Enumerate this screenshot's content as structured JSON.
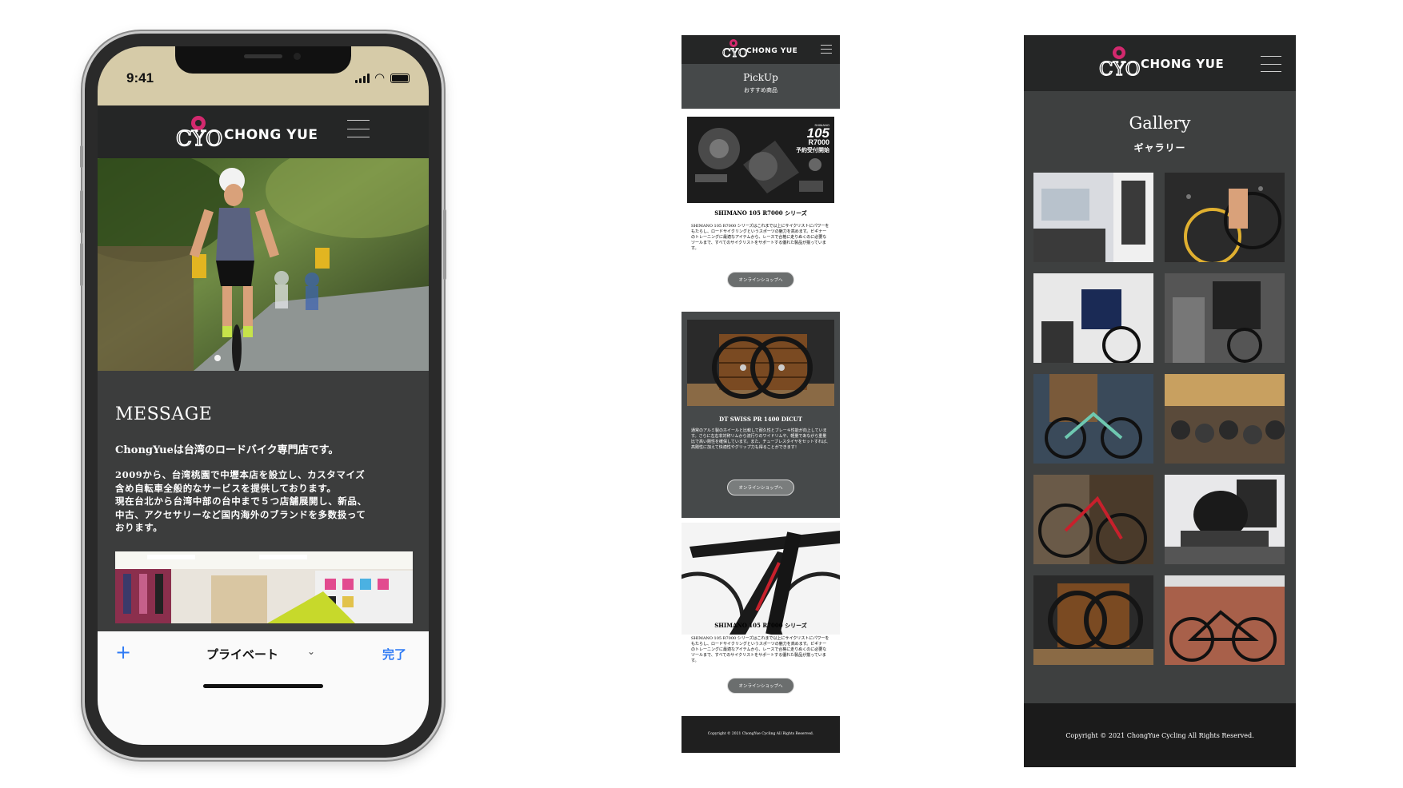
{
  "phone": {
    "status": {
      "time": "9:41"
    },
    "brand": {
      "logo_mark": "CYO",
      "logo_text": "CHONG YUE"
    },
    "message": {
      "title": "MESSAGE",
      "lead": "ChongYueは台湾のロードバイク専門店です。",
      "body_line1": "2009から、台湾桃園で中壢本店を設立し、カスタマイズ含め自転車全般的なサービスを提供しております。",
      "body_line2": "現在台北から台湾中部の台中まで５つ店舗展開し、新品、中古、アクセサリーなど国内海外のブランドを多数扱っております。"
    },
    "safari": {
      "plus": "+",
      "private": "プライベート",
      "chevron": "⌄",
      "done": "完了"
    }
  },
  "pickup": {
    "brand": {
      "logo_mark": "CYO",
      "logo_text": "CHONG YUE"
    },
    "title": "PickUp",
    "subtitle": "おすすめ商品",
    "cards": [
      {
        "title": "SHIMANO 105 R7000 シリーズ",
        "text": "SHIMANO 105 R7000 シリーズはこれまで以上にサイクリストにパワーをもたらし、ロードサイクリングというスポーツの魅力を高めます。ビギナーのトレーニングに最適なアイテムから、レースで合格に走りぬくのに必要なツールまで、すべてのサイクリストをサポートする優れた製品が揃っています。",
        "button": "オンラインショップへ",
        "image_badge_brand": "SHIMANO",
        "image_badge_model": "105",
        "image_badge_series": "R7000",
        "image_badge_note": "予約受付開始"
      },
      {
        "title": "DT SWISS PR 1400 DICUT",
        "text": "通常のアルミ製のホイールと比較して耐久性とブレーキ性能が向上しています。さらに左右非対称リムから流行りのワイドリムや、軽量であながら重量比で高い剛性を確保しています。また、チューブレスタイヤをセットすれば、高剛性に加えて快適性やグリップ力も得ることができます！",
        "button": "オンラインショップへ"
      },
      {
        "title": "SHIMANO 105 R7000 シリーズ",
        "text": "SHIMANO 105 R7000 シリーズはこれまで以上にサイクリストにパワーをもたらし、ロードサイクリングというスポーツの魅力を高めます。ビギナーのトレーニングに最適なアイテムから、レースで合格に走りぬくのに必要なツールまで、すべてのサイクリストをサポートする優れた製品が揃っています。",
        "button": "オンラインショップへ"
      }
    ],
    "footer": "Copyright © 2021 ChongYue Cycling All Rights Reserved."
  },
  "gallery": {
    "brand": {
      "logo_mark": "CYO",
      "logo_text": "CHONG YUE"
    },
    "title": "Gallery",
    "subtitle": "ギャラリー",
    "footer": "Copyright © 2021 ChongYue Cycling All Rights Reserved."
  },
  "colors": {
    "header_bg": "#252626",
    "panel_bg": "#3c3d3d",
    "logo_pink": "#d3296e",
    "ios_blue": "#2f7bf5"
  }
}
